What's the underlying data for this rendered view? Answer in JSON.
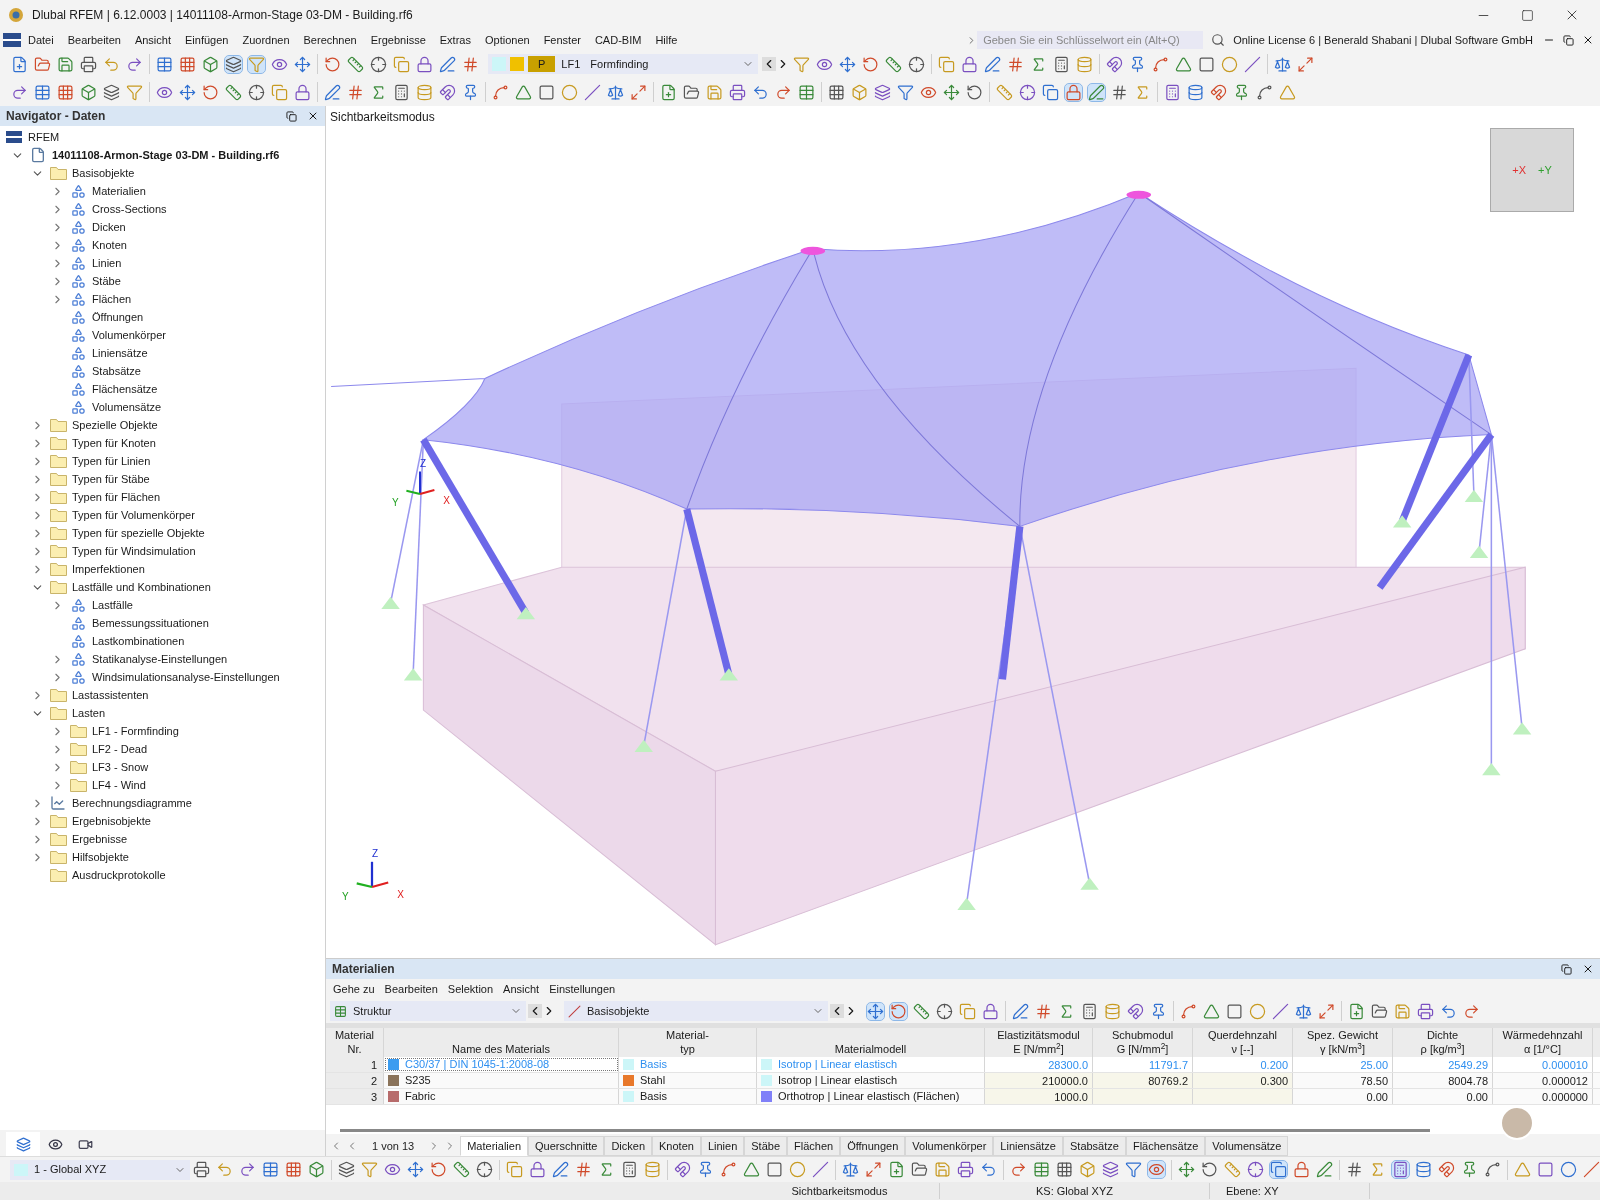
{
  "window": {
    "title": "Dlubal RFEM | 6.12.0003 | 14011108-Armon-Stage 03-DM - Building.rf6"
  },
  "menu": [
    "Datei",
    "Bearbeiten",
    "Ansicht",
    "Einfügen",
    "Zuordnen",
    "Berechnen",
    "Ergebnisse",
    "Extras",
    "Optionen",
    "Fenster",
    "CAD-BIM",
    "Hilfe"
  ],
  "search": {
    "placeholder": "Geben Sie ein Schlüsselwort ein (Alt+Q)"
  },
  "license": "Online License 6 | Benerald Shabani | Dlubal Software GmbH",
  "load_case": {
    "badge": "P",
    "code": "LF1",
    "name": "Formfinding"
  },
  "navigator": {
    "title": "Navigator - Daten",
    "root": "RFEM",
    "tree": [
      {
        "label": "14011108-Armon-Stage 03-DM - Building.rf6",
        "kind": "file",
        "expanded": true,
        "children": [
          {
            "label": "Basisobjekte",
            "kind": "folder",
            "expanded": true,
            "children": [
              {
                "label": "Materialien",
                "kind": "object",
                "expanded": false
              },
              {
                "label": "Cross-Sections",
                "kind": "object",
                "expanded": false
              },
              {
                "label": "Dicken",
                "kind": "object",
                "expanded": false
              },
              {
                "label": "Knoten",
                "kind": "object",
                "expanded": false
              },
              {
                "label": "Linien",
                "kind": "object",
                "expanded": false
              },
              {
                "label": "Stäbe",
                "kind": "object",
                "expanded": false
              },
              {
                "label": "Flächen",
                "kind": "object",
                "expanded": false
              },
              {
                "label": "Öffnungen",
                "kind": "object"
              },
              {
                "label": "Volumenkörper",
                "kind": "object"
              },
              {
                "label": "Liniensätze",
                "kind": "object"
              },
              {
                "label": "Stabsätze",
                "kind": "object"
              },
              {
                "label": "Flächensätze",
                "kind": "object"
              },
              {
                "label": "Volumensätze",
                "kind": "object"
              }
            ]
          },
          {
            "label": "Spezielle Objekte",
            "kind": "folder",
            "expanded": false
          },
          {
            "label": "Typen für Knoten",
            "kind": "folder",
            "expanded": false
          },
          {
            "label": "Typen für Linien",
            "kind": "folder",
            "expanded": false
          },
          {
            "label": "Typen für Stäbe",
            "kind": "folder",
            "expanded": false
          },
          {
            "label": "Typen für Flächen",
            "kind": "folder",
            "expanded": false
          },
          {
            "label": "Typen für Volumenkörper",
            "kind": "folder",
            "expanded": false
          },
          {
            "label": "Typen für spezielle Objekte",
            "kind": "folder",
            "expanded": false
          },
          {
            "label": "Typen für Windsimulation",
            "kind": "folder",
            "expanded": false
          },
          {
            "label": "Imperfektionen",
            "kind": "folder",
            "expanded": false
          },
          {
            "label": "Lastfälle und Kombinationen",
            "kind": "folder",
            "expanded": true,
            "children": [
              {
                "label": "Lastfälle",
                "kind": "object",
                "expanded": false
              },
              {
                "label": "Bemessungssituationen",
                "kind": "object"
              },
              {
                "label": "Lastkombinationen",
                "kind": "object"
              },
              {
                "label": "Statikanalyse-Einstellungen",
                "kind": "object",
                "expanded": false
              },
              {
                "label": "Windsimulationsanalyse-Einstellungen",
                "kind": "object",
                "expanded": false
              }
            ]
          },
          {
            "label": "Lastassistenten",
            "kind": "folder",
            "expanded": false
          },
          {
            "label": "Lasten",
            "kind": "folder",
            "expanded": true,
            "children": [
              {
                "label": "LF1 - Formfinding",
                "kind": "folder",
                "expanded": false
              },
              {
                "label": "LF2 - Dead",
                "kind": "folder",
                "expanded": false
              },
              {
                "label": "LF3 - Snow",
                "kind": "folder",
                "expanded": false
              },
              {
                "label": "LF4 - Wind",
                "kind": "folder",
                "expanded": false
              }
            ]
          },
          {
            "label": "Berechnungsdiagramme",
            "kind": "chart",
            "expanded": false
          },
          {
            "label": "Ergebnisobjekte",
            "kind": "folder",
            "expanded": false
          },
          {
            "label": "Ergebnisse",
            "kind": "folder",
            "expanded": false
          },
          {
            "label": "Hilfsobjekte",
            "kind": "folder",
            "expanded": false
          },
          {
            "label": "Ausdruckprotokolle",
            "kind": "folder"
          }
        ]
      }
    ]
  },
  "viewport": {
    "label": "Sichtbarkeitsmodus",
    "cube_labels": [
      "+X",
      "+Y"
    ],
    "model_axes": [
      "Z",
      "Y",
      "X"
    ],
    "corner_axes": [
      "Z",
      "Y",
      "X"
    ]
  },
  "table_panel": {
    "title": "Materialien",
    "menu": [
      "Gehe zu",
      "Bearbeiten",
      "Selektion",
      "Ansicht",
      "Einstellungen"
    ],
    "filters": [
      "Struktur",
      "Basisobjekte"
    ],
    "columns": [
      {
        "label": "Material",
        "unit": "Nr."
      },
      {
        "unit": "Name des Materials"
      },
      {
        "label": "Material-",
        "unit": "typ"
      },
      {
        "unit": "Materialmodell"
      },
      {
        "label": "Elastizitätsmodul",
        "unit": "E [N/mm$^{2}$]"
      },
      {
        "label": "Schubmodul",
        "unit": "G [N/mm$^{2}$]"
      },
      {
        "label": "Querdehnzahl",
        "unit": "ν [--]"
      },
      {
        "label": "Spez. Gewicht",
        "unit": "γ [kN/m$^{3}$]"
      },
      {
        "label": "Dichte",
        "unit": "ρ [kg/m$^{3}$]"
      },
      {
        "label": "Wärmedehnzahl",
        "unit": "α [1/°C]"
      }
    ],
    "rows": [
      {
        "selected": true,
        "nr": "1",
        "name": {
          "text": "C30/37 | DIN 1045-1:2008-08",
          "color": "#3b9cf0"
        },
        "type": {
          "text": "Basis",
          "color": "#ccf6f8"
        },
        "model": {
          "text": "Isotrop | Linear elastisch",
          "color": "#ccf6f8"
        },
        "values": {
          "e": "28300.0",
          "g": "11791.7",
          "nu": "0.200",
          "gamma": "25.00",
          "rho": "2549.29",
          "alpha": "0.000010"
        }
      },
      {
        "selected": false,
        "nr": "2",
        "name": {
          "text": "S235",
          "color": "#8a735a"
        },
        "type": {
          "text": "Stahl",
          "color": "#e8782a"
        },
        "model": {
          "text": "Isotrop | Linear elastisch",
          "color": "#ccf6f8"
        },
        "values": {
          "e": "210000.0",
          "g": "80769.2",
          "nu": "0.300",
          "gamma": "78.50",
          "rho": "8004.78",
          "alpha": "0.000012"
        }
      },
      {
        "selected": false,
        "nr": "3",
        "name": {
          "text": "Fabric",
          "color": "#b76b6b"
        },
        "type": {
          "text": "Basis",
          "color": "#ccf6f8"
        },
        "model": {
          "text": "Orthotrop | Linear elastisch (Flächen)",
          "color": "#8080f8"
        },
        "values": {
          "e": "1000.0",
          "gamma": "0.00",
          "rho": "0.00",
          "alpha": "0.000000"
        }
      }
    ],
    "pager": "1 von 13",
    "tabs": [
      {
        "label": "Materialien",
        "selected": true
      },
      {
        "label": "Querschnitte",
        "selected": false
      },
      {
        "label": "Dicken",
        "selected": false
      },
      {
        "label": "Knoten",
        "selected": false
      },
      {
        "label": "Linien",
        "selected": false
      },
      {
        "label": "Stäbe",
        "selected": false
      },
      {
        "label": "Flächen",
        "selected": false
      },
      {
        "label": "Öffnungen",
        "selected": false
      },
      {
        "label": "Volumenkörper",
        "selected": false
      },
      {
        "label": "Liniensätze",
        "selected": false
      },
      {
        "label": "Stabsätze",
        "selected": false
      },
      {
        "label": "Flächensätze",
        "selected": false
      },
      {
        "label": "Volumensätze",
        "selected": false
      }
    ]
  },
  "coordinate_system": "1 - Global XYZ",
  "status_bar": [
    "Sichtbarkeitsmodus",
    "KS: Global XYZ",
    "Ebene: XY"
  ]
}
